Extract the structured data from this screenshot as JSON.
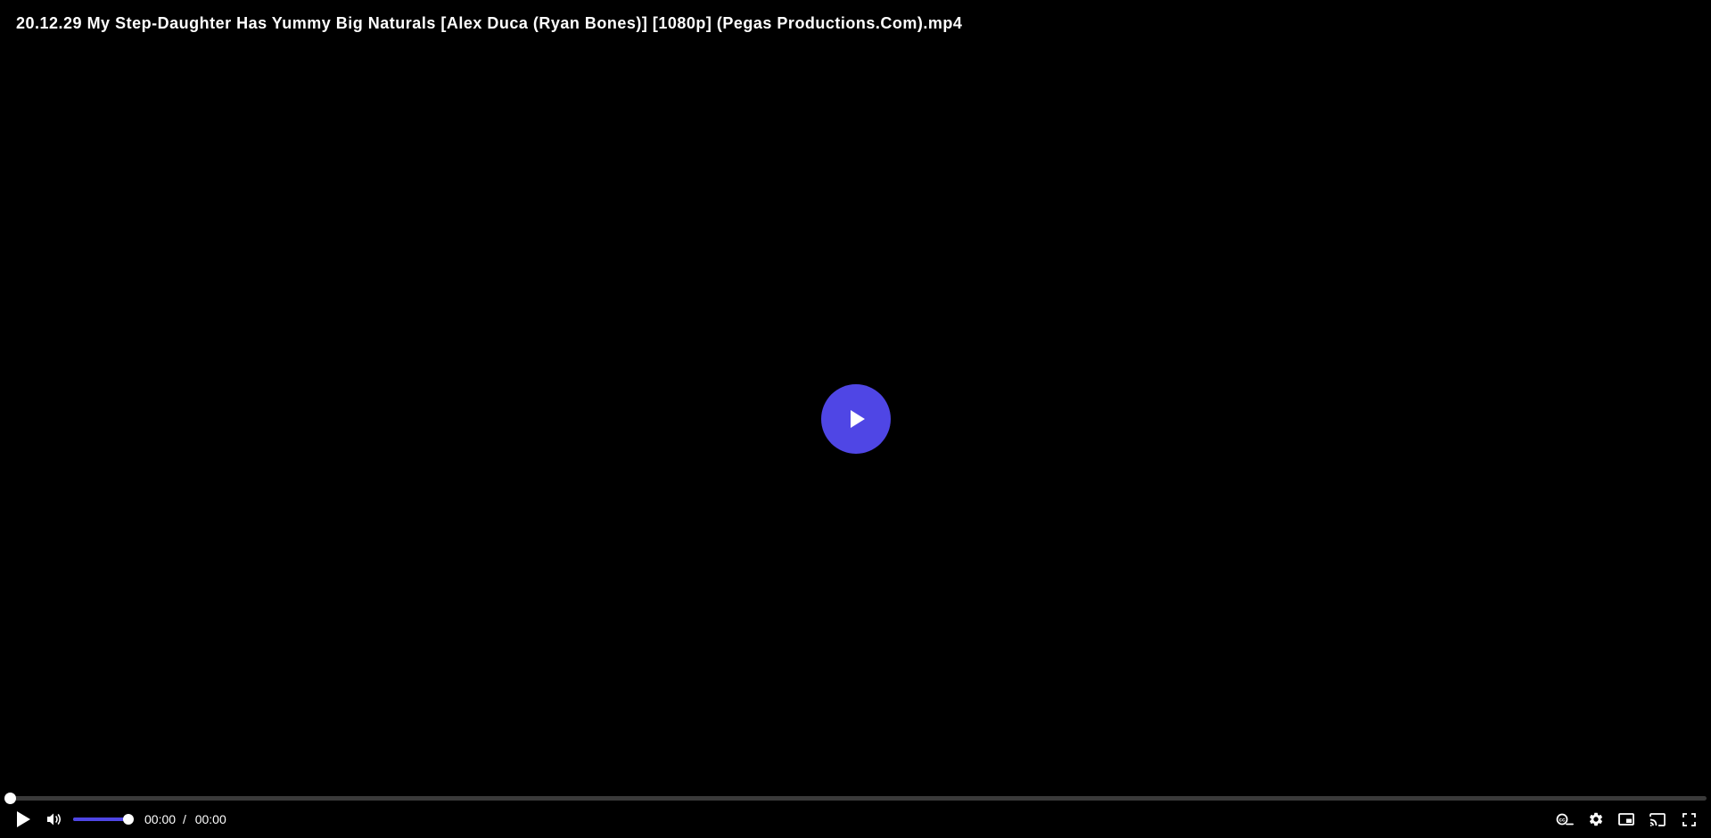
{
  "video": {
    "title": "20.12.29 My Step-Daughter Has Yummy Big Naturals [Alex Duca (Ryan Bones)] [1080p] (Pegas Productions.Com).mp4"
  },
  "controls": {
    "current_time": "00:00",
    "separator": "/",
    "duration": "00:00",
    "progress_fraction": 0,
    "volume_fraction": 1
  },
  "icons": {
    "big_play": "play-icon",
    "play": "play-icon",
    "volume": "volume-icon",
    "captions": "captions-icon",
    "settings": "gear-icon",
    "pip": "picture-in-picture-icon",
    "cast": "cast-icon",
    "fullscreen": "fullscreen-icon"
  },
  "colors": {
    "accent": "#4f46e5",
    "background": "#000000",
    "track": "#3a3a3a"
  }
}
